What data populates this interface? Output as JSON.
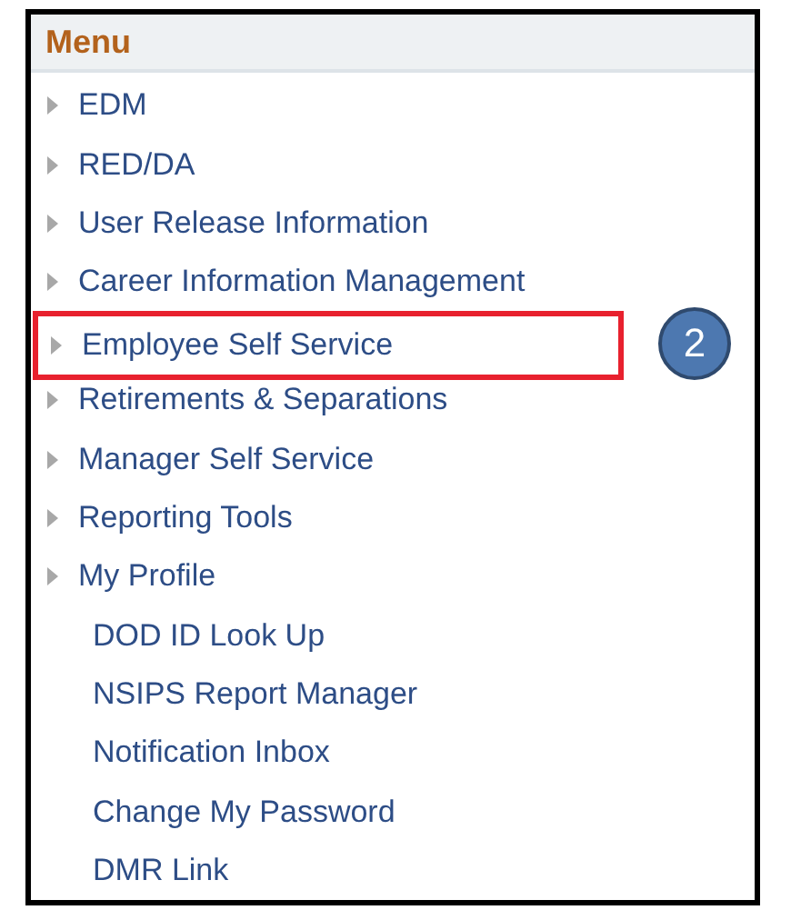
{
  "menu": {
    "title": "Menu",
    "items": [
      {
        "label": "EDM",
        "kind": "folder",
        "highlighted": false
      },
      {
        "label": "RED/DA",
        "kind": "folder",
        "highlighted": false
      },
      {
        "label": "User Release Information",
        "kind": "folder",
        "highlighted": false
      },
      {
        "label": "Career Information Management",
        "kind": "folder",
        "highlighted": false
      },
      {
        "label": "Employee Self Service",
        "kind": "folder",
        "highlighted": true,
        "callout": "2"
      },
      {
        "label": "Retirements & Separations",
        "kind": "folder",
        "highlighted": false
      },
      {
        "label": "Manager Self Service",
        "kind": "folder",
        "highlighted": false
      },
      {
        "label": "Reporting Tools",
        "kind": "folder",
        "highlighted": false
      },
      {
        "label": "My Profile",
        "kind": "folder",
        "highlighted": false
      },
      {
        "label": "DOD ID Look Up",
        "kind": "link",
        "highlighted": false
      },
      {
        "label": "NSIPS Report Manager",
        "kind": "link",
        "highlighted": false
      },
      {
        "label": "Notification Inbox",
        "kind": "link",
        "highlighted": false
      },
      {
        "label": "Change My Password",
        "kind": "link",
        "highlighted": false
      },
      {
        "label": "DMR Link",
        "kind": "link",
        "highlighted": false
      }
    ]
  }
}
